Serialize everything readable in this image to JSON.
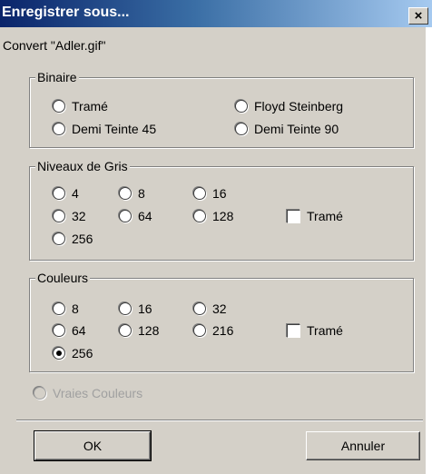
{
  "window": {
    "title": "Enregistrer sous...",
    "close_glyph": "×",
    "subtitle": "Convert \"Adler.gif\""
  },
  "binaire": {
    "legend": "Binaire",
    "options": [
      "Tramé",
      "Floyd Steinberg",
      "Demi Teinte 45",
      "Demi Teinte 90"
    ],
    "selected": null
  },
  "gris": {
    "legend": "Niveaux de Gris",
    "options": [
      "4",
      "8",
      "16",
      "32",
      "64",
      "128",
      "256"
    ],
    "trame_label": "Tramé",
    "trame_checked": false
  },
  "couleurs": {
    "legend": "Couleurs",
    "options": [
      "8",
      "16",
      "32",
      "64",
      "128",
      "216",
      "256"
    ],
    "selected": "256",
    "trame_label": "Tramé",
    "trame_checked": false
  },
  "vraies_couleurs": {
    "label": "Vraies Couleurs",
    "enabled": false
  },
  "buttons": {
    "ok": "OK",
    "cancel": "Annuler"
  }
}
